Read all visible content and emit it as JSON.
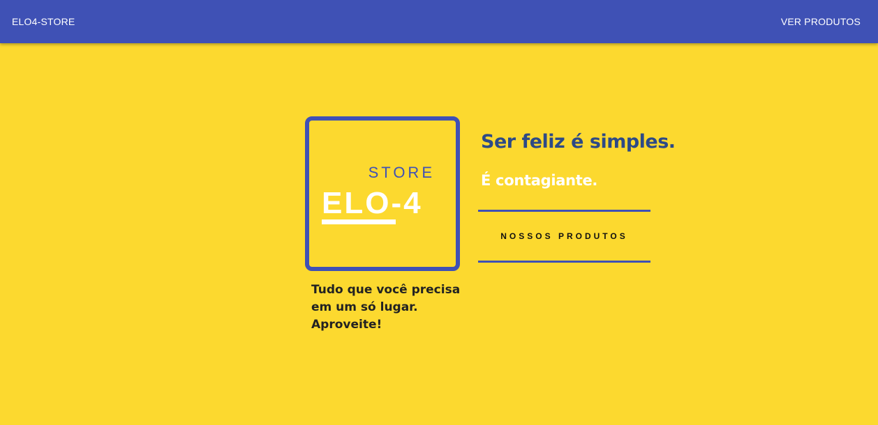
{
  "header": {
    "brand": "ELO4-STORE",
    "nav_link": "VER PRODUTOS"
  },
  "logo": {
    "store_text": "STORE",
    "name_text": "ELO-4"
  },
  "hero": {
    "tagline_line1": "Tudo que você precisa",
    "tagline_line2": "em um só lugar.",
    "tagline_line3": "Aproveite!",
    "headline": "Ser feliz é simples.",
    "subline": "É contagiante.",
    "cta_label": "NOSSOS PRODUTOS"
  },
  "colors": {
    "background": "#fcd92f",
    "primary": "#3f51b5",
    "headline": "#2d4a86"
  }
}
